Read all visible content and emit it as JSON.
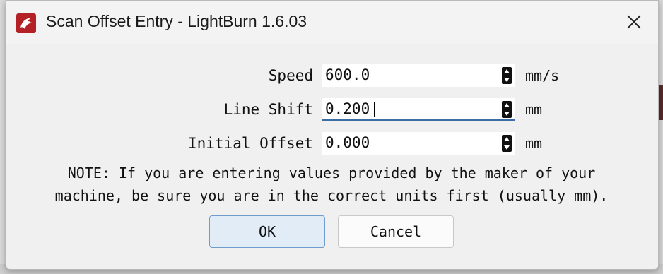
{
  "window": {
    "title": "Scan Offset Entry - LightBurn 1.6.03",
    "icon": "lightburn-logo-icon",
    "close_icon": "close-icon"
  },
  "fields": [
    {
      "label": "Speed",
      "value": "600.0",
      "unit": "mm/s",
      "focused": false
    },
    {
      "label": "Line Shift",
      "value": "0.200",
      "unit": "mm",
      "focused": true
    },
    {
      "label": "Initial Offset",
      "value": "0.000",
      "unit": "mm",
      "focused": false
    }
  ],
  "note": {
    "line1": "NOTE: If you are entering values provided by the maker of your",
    "line2": "machine, be sure you are in the correct units first (usually mm)."
  },
  "buttons": {
    "ok": "OK",
    "cancel": "Cancel"
  },
  "colors": {
    "accent": "#3a6ea5",
    "ok_bg": "#e1ecf7",
    "icon_red": "#b32025"
  }
}
